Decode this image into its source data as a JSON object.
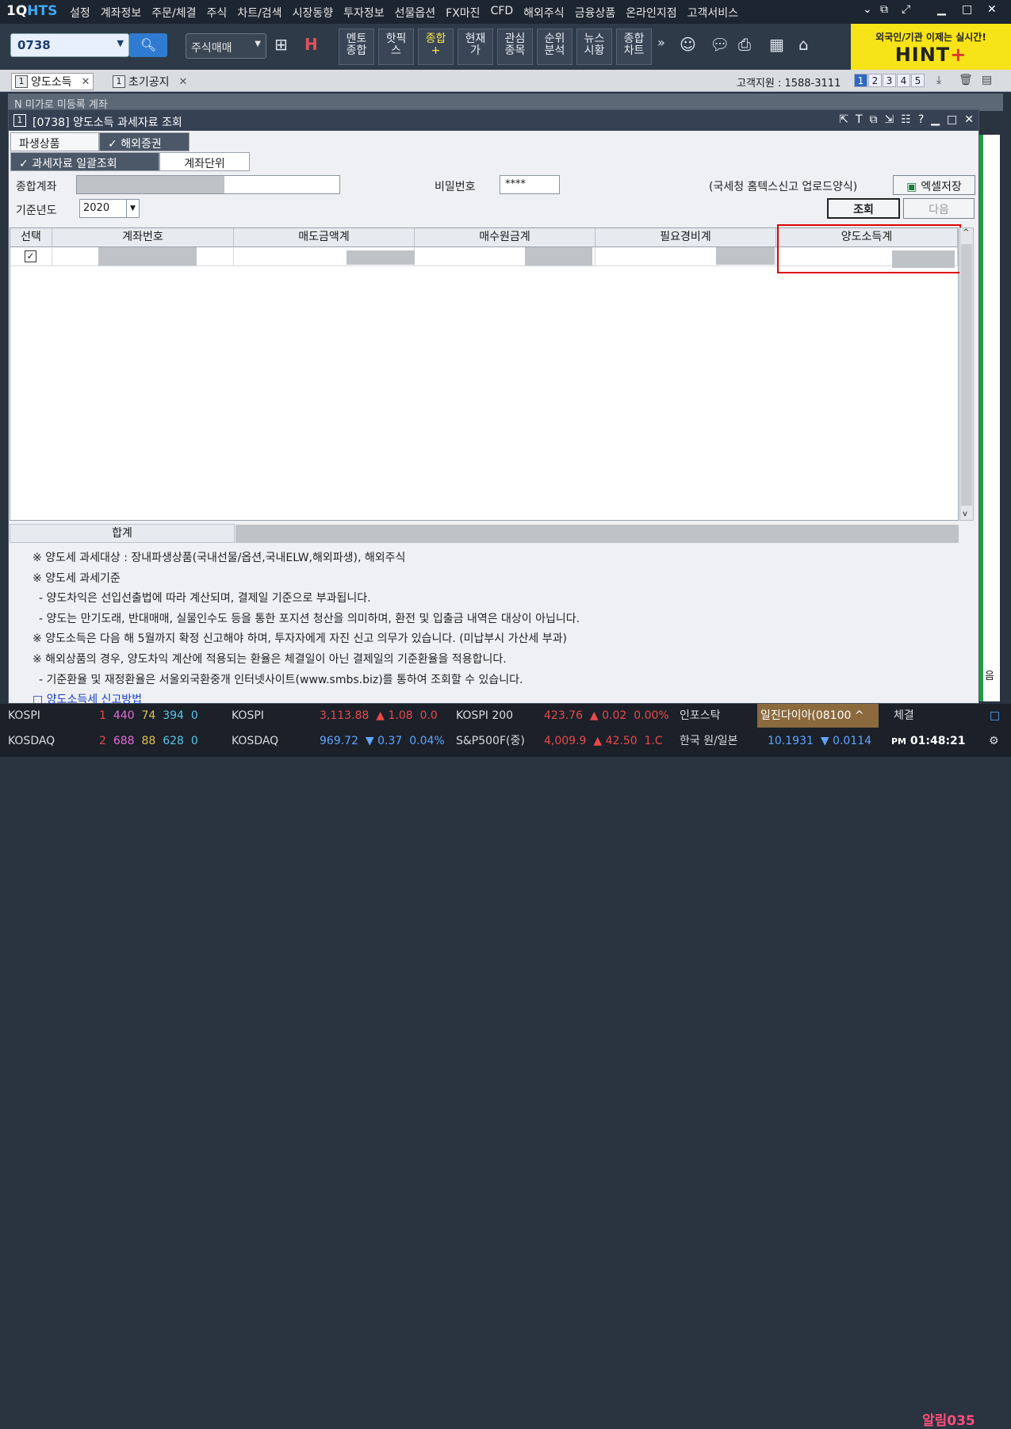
{
  "app": {
    "logo_1": "1Q",
    "logo_2": "HTS"
  },
  "menu": [
    "설정",
    "계좌정보",
    "주문/체결",
    "주식",
    "차트/검색",
    "시장동향",
    "투자정보",
    "선물옵션",
    "FX마진",
    "CFD",
    "해외주식",
    "금융상품",
    "온라인지점",
    "고객서비스"
  ],
  "toolbar": {
    "account": "0738",
    "trade_select": "주식매매",
    "buttons": [
      "멘토\n종합",
      "핫픽\n스",
      "종합\n+",
      "현재\n가",
      "관심\n종목",
      "순위\n분석",
      "뉴스\n시황",
      "종합\n차트"
    ],
    "hint_top": "외국인/기관 이제는 실시간!",
    "hint_main": "HINT",
    "hint_plus": "+"
  },
  "tabs": [
    {
      "num": "1",
      "label": "양도소득"
    },
    {
      "num": "1",
      "label": "초기공지"
    }
  ],
  "customer_support": "고객지원 : 1588-3111",
  "pages": [
    "1",
    "2",
    "3",
    "4",
    "5"
  ],
  "bg_window_title": "N  미가로  미등록  계좌",
  "window": {
    "num": "1",
    "title": "[0738] 양도소득 과세자료 조회"
  },
  "subtabs": {
    "derivatives": "파생상품",
    "overseas": "해외증권",
    "bulk": "과세자료 일괄조회",
    "unit": "계좌단위"
  },
  "form": {
    "account_label": "종합계좌",
    "password_label": "비밀번호",
    "password_value": "****",
    "year_label": "기준년도",
    "year_value": "2020",
    "upload_note": "(국세청 홈텍스신고 업로드양식)",
    "excel_button": "엑셀저장",
    "query_button": "조회",
    "next_button": "다음"
  },
  "grid": {
    "headers": [
      "선택",
      "계좌번호",
      "매도금액계",
      "매수원금계",
      "필요경비계",
      "양도소득계"
    ],
    "total_label": "합계"
  },
  "notes": [
    "※ 양도세 과세대상 : 장내파생상품(국내선물/옵션,국내ELW,해외파생), 해외주식",
    "※ 양도세 과세기준",
    "- 양도차익은 선입선출법에 따라 계산되며, 결제일 기준으로 부과됩니다.",
    "- 양도는 만기도래, 반대매매, 실물인수도 등을 통한 포지션 청산을 의미하며, 환전 및 입출금 내역은 대상이 아닙니다.",
    "※ 양도소득은 다음 해 5월까지 확정 신고해야 하며, 투자자에게 자진 신고 의무가 있습니다. (미납부시 가산세 부과)",
    "※ 해외상품의 경우, 양도차익 계산에 적용되는 환율은 체결일이 아닌 결제일의 기준환율을 적용합니다.",
    "- 기준환율 및 재정환율은 서울외국환중개 인터넷사이트(www.smbs.biz)를 통하여 조회할 수 있습니다."
  ],
  "notes_link": "□ 양도소득세 신고방법",
  "right_edge": "음",
  "ticker": {
    "row1": {
      "market": "KOSPI",
      "c1": "1",
      "c2": "440",
      "c3": "74",
      "c4": "394",
      "c5": "0",
      "idx": "KOSPI",
      "value": "3,113.88",
      "arrow": "▲",
      "chg": "1.08",
      "pct": "0.0",
      "k200": "KOSPI 200",
      "k200v": "423.76",
      "k200arrow": "▲",
      "k200chg": "0.02",
      "k200pct": "0.00%",
      "news": "인포스탁",
      "stock": "일진다이아(08100",
      "stock_arrow": "^",
      "label": "체결",
      "alarm": "알림035",
      "flag": "□"
    },
    "row2": {
      "market": "KOSDAQ",
      "c1": "2",
      "c2": "688",
      "c3": "88",
      "c4": "628",
      "c5": "0",
      "idx": "KOSDAQ",
      "value": "969.72",
      "arrow": "▼",
      "chg": "0.37",
      "pct": "0.04%",
      "sp": "S&P500F(중)",
      "spv": "4,009.9",
      "sparrow": "▲",
      "spchg": "42.50",
      "sppct": "1.C",
      "fx": "한국 원/일본",
      "fxv": "10.1931",
      "fxarrow": "▼",
      "fxchg": "0.0114",
      "ampm": "PM",
      "time": "01:48:21"
    }
  },
  "colors": {
    "accent": "#2e7bd1",
    "highlight_box": "#e00000",
    "hint_bg": "#f6e318"
  }
}
